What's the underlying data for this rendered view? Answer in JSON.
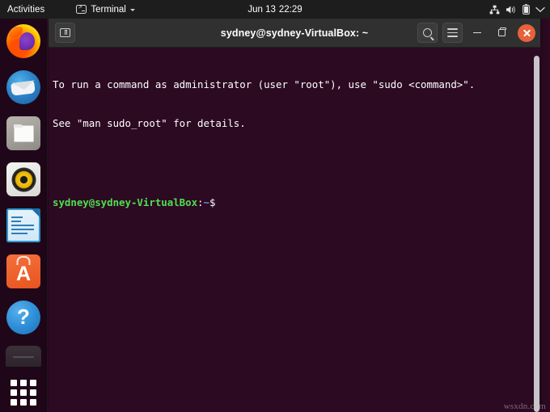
{
  "topbar": {
    "activities_label": "Activities",
    "app_indicator": {
      "icon": "terminal-icon",
      "label": "Terminal",
      "chevron": "chevron-down-icon"
    },
    "clock": {
      "date": "Jun 13",
      "time": "22:29"
    },
    "system_icons": [
      "network-icon",
      "volume-icon",
      "battery-icon",
      "chevron-down-icon"
    ]
  },
  "dock": {
    "items": [
      {
        "name": "firefox",
        "label": "Firefox"
      },
      {
        "name": "thunderbird",
        "label": "Thunderbird Mail"
      },
      {
        "name": "files",
        "label": "Files"
      },
      {
        "name": "rhythmbox",
        "label": "Rhythmbox"
      },
      {
        "name": "libreoffice-writer",
        "label": "LibreOffice Writer"
      },
      {
        "name": "ubuntu-software",
        "label": "Ubuntu Software"
      },
      {
        "name": "help",
        "label": "Help"
      },
      {
        "name": "trash",
        "label": "Trash"
      }
    ],
    "show_applications_label": "Show Applications"
  },
  "window": {
    "title": "sydney@sydney-VirtualBox: ~",
    "new_tab_label": "New Tab",
    "search_label": "Search",
    "menu_label": "Menu",
    "minimize_label": "Minimize",
    "maximize_label": "Maximize",
    "close_label": "Close"
  },
  "terminal": {
    "lines": [
      "To run a command as administrator (user \"root\"), use \"sudo <command>\".",
      "See \"man sudo_root\" for details.",
      ""
    ],
    "prompt": {
      "user_host": "sydney@sydney-VirtualBox",
      "colon": ":",
      "path": "~",
      "symbol": "$"
    }
  },
  "watermark": "wsxdn.com",
  "colors": {
    "topbar_bg": "#1d1d1d",
    "titlebar_bg": "#303030",
    "terminal_bg": "#2c0a22",
    "close_button": "#e8613c",
    "prompt_user": "#4ee04e",
    "prompt_path": "#6d8cf0",
    "accent_orange": "#e8541f"
  }
}
